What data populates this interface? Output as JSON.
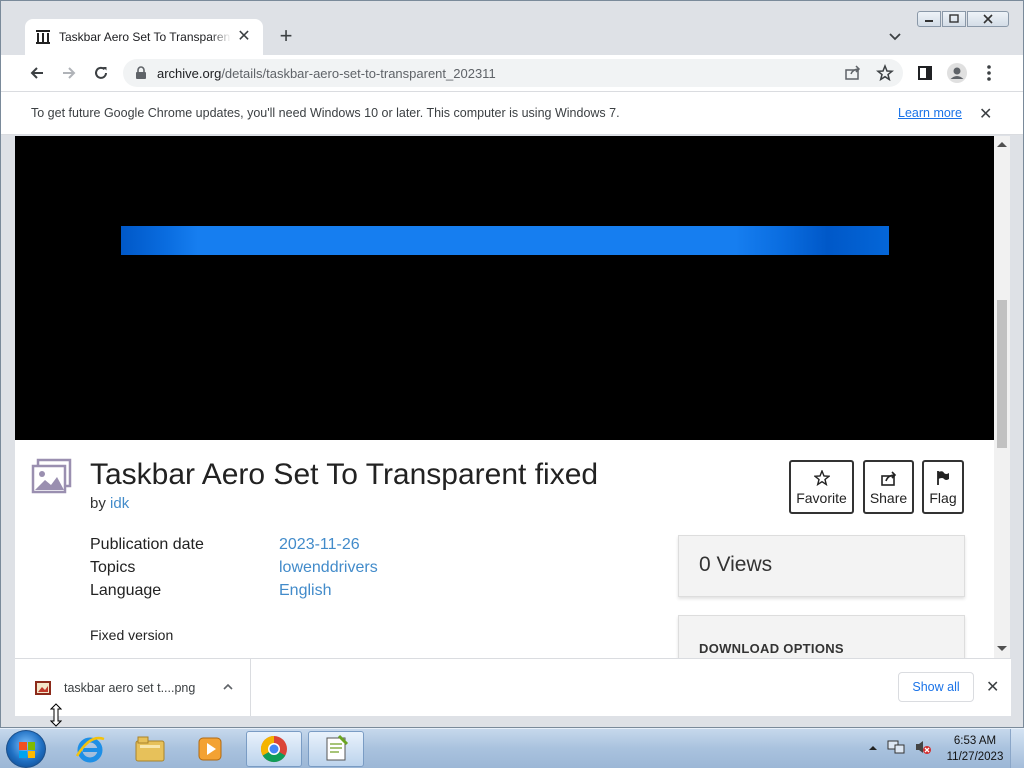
{
  "browser": {
    "tab_title": "Taskbar Aero Set To Transparent fixed",
    "url_host": "archive.org",
    "url_path": "/details/taskbar-aero-set-to-transparent_202311",
    "infobar_message": "To get future Google Chrome updates, you'll need Windows 10 or later. This computer is using Windows 7.",
    "infobar_link": "Learn more"
  },
  "item": {
    "title": "Taskbar Aero Set To Transparent fixed",
    "by_prefix": "by",
    "author": "idk",
    "actions": {
      "favorite": "Favorite",
      "share": "Share",
      "flag": "Flag"
    },
    "metadata": [
      {
        "key": "Publication date",
        "value": "2023-11-26"
      },
      {
        "key": "Topics",
        "value": "lowenddrivers"
      },
      {
        "key": "Language",
        "value": "English"
      }
    ],
    "description": "Fixed version",
    "views": "0 Views",
    "download_options": "DOWNLOAD OPTIONS"
  },
  "download_shelf": {
    "filename": "taskbar aero set t....png",
    "show_all": "Show all"
  },
  "taskbar": {
    "time": "6:53 AM",
    "date": "11/27/2023"
  },
  "colors": {
    "link": "#428bca",
    "chrome_link": "#1a73e8",
    "theater_bg": "#000000",
    "progress_blue": "#167ef0"
  }
}
